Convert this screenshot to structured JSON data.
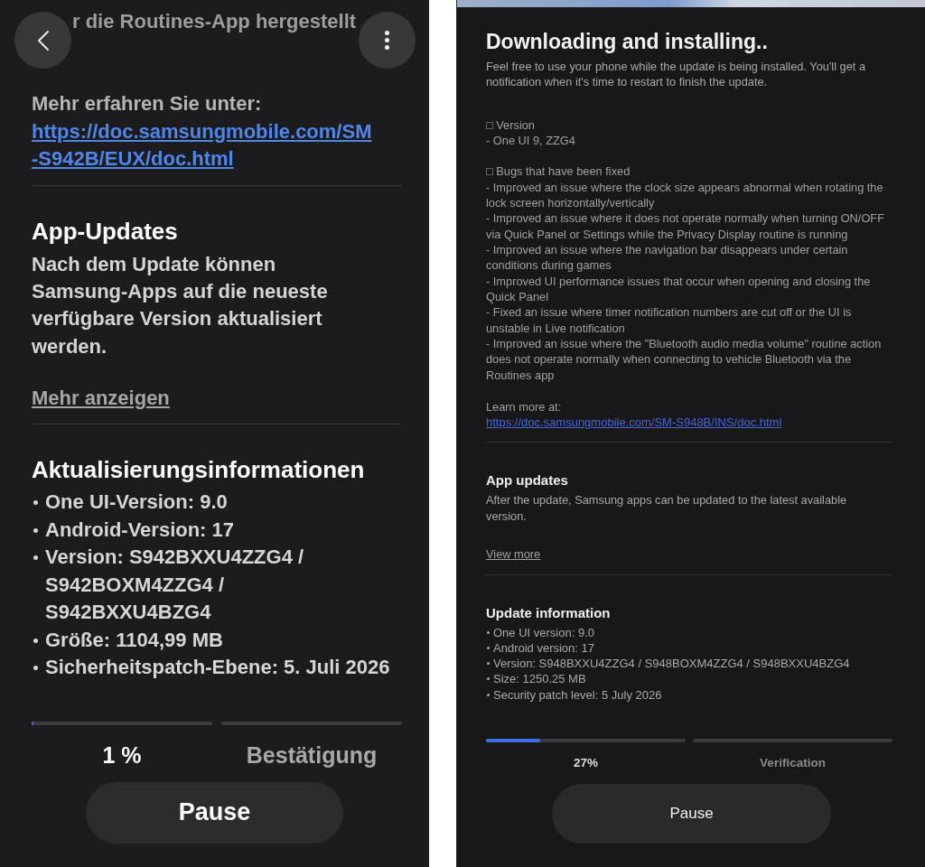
{
  "screens": [
    {
      "kind": "large",
      "top_fragment": "r die Routines-App hergestellt",
      "blocks": [
        {
          "kind": "label",
          "text": "Mehr erfahren Sie unter:"
        },
        {
          "kind": "link",
          "text": "https://doc.samsungmobile.com/SM-S942B/EUX/doc.html"
        },
        {
          "kind": "divider"
        },
        {
          "kind": "heading",
          "text": "App-Updates"
        },
        {
          "kind": "paragraph",
          "text": "Nach dem Update können Samsung-Apps auf die neueste verfügbare Version aktualisiert werden."
        },
        {
          "kind": "more",
          "text": "Mehr anzeigen"
        },
        {
          "kind": "divider"
        },
        {
          "kind": "heading",
          "text": "Aktualisierungsinformationen"
        },
        {
          "kind": "bullets",
          "items": [
            "One UI-Version: 9.0",
            "Android-Version: 17",
            "Version: S942BXXU4ZZG4 / S942BOXM4ZZG4 / S942BXXU4BZG4",
            "Größe: 1104,99 MB",
            "Sicherheitspatch-Ebene: 5. Juli 2026"
          ]
        }
      ],
      "progress": {
        "steps": [
          {
            "label": "1 %",
            "level": 0.01,
            "selected": true
          },
          {
            "label": "Bestätigung",
            "selected": false
          }
        ]
      },
      "button": {
        "label": "Pause"
      }
    },
    {
      "kind": "compact",
      "title": "Downloading and installing..",
      "description": "Feel free to use your phone while the update is being installed. You'll get a notification when it's time to restart to finish the update.",
      "blocks": [
        {
          "kind": "notes",
          "lines": [
            "□ Version",
            "- One UI 9, ZZG4"
          ]
        },
        {
          "kind": "notes",
          "lines": [
            "□ Bugs that have been fixed",
            "- Improved an issue where the clock size appears abnormal when rotating the lock screen horizontally/vertically",
            "- Improved an issue where it does not operate normally when turning ON/OFF via Quick Panel or Settings while the Privacy Display routine is running",
            "- Improved an issue where the navigation bar disappears under certain conditions during games",
            "- Improved UI performance issues that occur when opening and closing the Quick Panel",
            "- Fixed an issue where timer notification numbers are cut off or the UI is unstable in Live notification",
            "- Improved an issue where the \"Bluetooth audio media volume\" routine action does not operate normally when connecting to vehicle Bluetooth via the Routines app"
          ]
        },
        {
          "kind": "label",
          "text": "Learn more at:"
        },
        {
          "kind": "link",
          "text": "https://doc.samsungmobile.com/SM-S948B/INS/doc.html"
        },
        {
          "kind": "divider"
        },
        {
          "kind": "heading",
          "text": "App updates"
        },
        {
          "kind": "paragraph",
          "text": "After the update, Samsung apps can be updated to the latest available version."
        },
        {
          "kind": "more",
          "text": "View more"
        },
        {
          "kind": "divider"
        },
        {
          "kind": "heading",
          "text": "Update information"
        },
        {
          "kind": "bullets",
          "items": [
            "One UI version: 9.0",
            "Android version: 17",
            "Version: S948BXXU4ZZG4 / S948BOXM4ZZG4 / S948BXXU4BZG4",
            "Size: 1250.25 MB",
            "Security patch level: 5 July 2026"
          ]
        }
      ],
      "progress": {
        "steps": [
          {
            "label": "27%",
            "level": 0.27,
            "selected": true
          },
          {
            "label": "Verification",
            "selected": false
          }
        ]
      },
      "button": {
        "label": "Pause"
      }
    }
  ]
}
